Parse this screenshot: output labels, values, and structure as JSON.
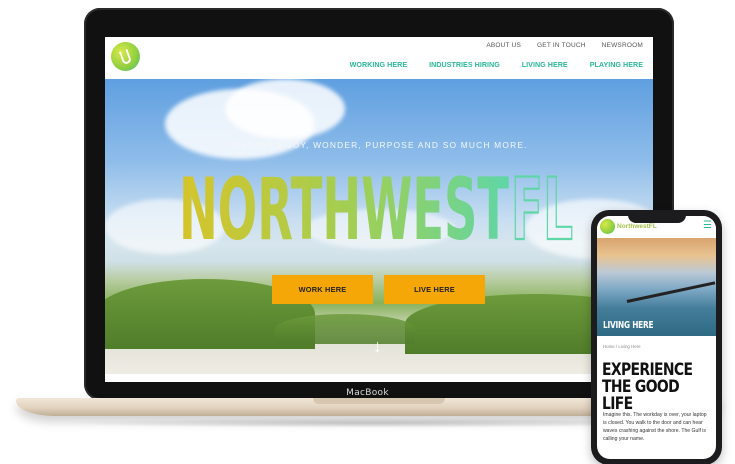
{
  "laptop": {
    "model_label": "MacBook"
  },
  "site": {
    "top_nav": [
      "ABOUT US",
      "GET IN TOUCH",
      "NEWSROOM"
    ],
    "main_nav": [
      "WORKING HERE",
      "INDUSTRIES HIRING",
      "LIVING HERE",
      "PLAYING HERE"
    ],
    "hero": {
      "subtitle": "DISCOVER JOY, WONDER, PURPOSE AND SO MUCH MORE.",
      "title_main": "NORTHWEST",
      "title_suffix": "FL",
      "buttons": [
        "WORK HERE",
        "LIVE HERE"
      ],
      "scroll_icon": "down-arrow-icon"
    }
  },
  "phone": {
    "brand": "NorthwestFL",
    "menu_icon": "hamburger-icon",
    "hero_title": "LIVING HERE",
    "breadcrumb": "Home / Living Here",
    "heading": "EXPERIENCE THE GOOD LIFE",
    "body": "Imagine this. The workday is over, your laptop is closed. You walk to the door and can hear waves crashing against the shore. The Gulf is calling your name."
  },
  "colors": {
    "accent_teal": "#2db89a",
    "button_orange": "#f4a707",
    "title_gradient_start": "#d6c42a",
    "title_gradient_end": "#5fd6a6"
  }
}
